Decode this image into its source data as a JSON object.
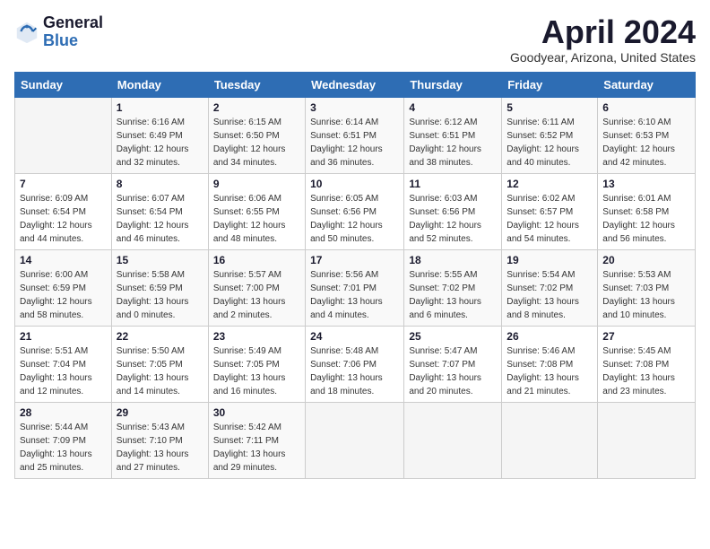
{
  "header": {
    "logo_general": "General",
    "logo_blue": "Blue",
    "title": "April 2024",
    "subtitle": "Goodyear, Arizona, United States"
  },
  "days_of_week": [
    "Sunday",
    "Monday",
    "Tuesday",
    "Wednesday",
    "Thursday",
    "Friday",
    "Saturday"
  ],
  "weeks": [
    [
      {
        "num": "",
        "info": ""
      },
      {
        "num": "1",
        "info": "Sunrise: 6:16 AM\nSunset: 6:49 PM\nDaylight: 12 hours\nand 32 minutes."
      },
      {
        "num": "2",
        "info": "Sunrise: 6:15 AM\nSunset: 6:50 PM\nDaylight: 12 hours\nand 34 minutes."
      },
      {
        "num": "3",
        "info": "Sunrise: 6:14 AM\nSunset: 6:51 PM\nDaylight: 12 hours\nand 36 minutes."
      },
      {
        "num": "4",
        "info": "Sunrise: 6:12 AM\nSunset: 6:51 PM\nDaylight: 12 hours\nand 38 minutes."
      },
      {
        "num": "5",
        "info": "Sunrise: 6:11 AM\nSunset: 6:52 PM\nDaylight: 12 hours\nand 40 minutes."
      },
      {
        "num": "6",
        "info": "Sunrise: 6:10 AM\nSunset: 6:53 PM\nDaylight: 12 hours\nand 42 minutes."
      }
    ],
    [
      {
        "num": "7",
        "info": "Sunrise: 6:09 AM\nSunset: 6:54 PM\nDaylight: 12 hours\nand 44 minutes."
      },
      {
        "num": "8",
        "info": "Sunrise: 6:07 AM\nSunset: 6:54 PM\nDaylight: 12 hours\nand 46 minutes."
      },
      {
        "num": "9",
        "info": "Sunrise: 6:06 AM\nSunset: 6:55 PM\nDaylight: 12 hours\nand 48 minutes."
      },
      {
        "num": "10",
        "info": "Sunrise: 6:05 AM\nSunset: 6:56 PM\nDaylight: 12 hours\nand 50 minutes."
      },
      {
        "num": "11",
        "info": "Sunrise: 6:03 AM\nSunset: 6:56 PM\nDaylight: 12 hours\nand 52 minutes."
      },
      {
        "num": "12",
        "info": "Sunrise: 6:02 AM\nSunset: 6:57 PM\nDaylight: 12 hours\nand 54 minutes."
      },
      {
        "num": "13",
        "info": "Sunrise: 6:01 AM\nSunset: 6:58 PM\nDaylight: 12 hours\nand 56 minutes."
      }
    ],
    [
      {
        "num": "14",
        "info": "Sunrise: 6:00 AM\nSunset: 6:59 PM\nDaylight: 12 hours\nand 58 minutes."
      },
      {
        "num": "15",
        "info": "Sunrise: 5:58 AM\nSunset: 6:59 PM\nDaylight: 13 hours\nand 0 minutes."
      },
      {
        "num": "16",
        "info": "Sunrise: 5:57 AM\nSunset: 7:00 PM\nDaylight: 13 hours\nand 2 minutes."
      },
      {
        "num": "17",
        "info": "Sunrise: 5:56 AM\nSunset: 7:01 PM\nDaylight: 13 hours\nand 4 minutes."
      },
      {
        "num": "18",
        "info": "Sunrise: 5:55 AM\nSunset: 7:02 PM\nDaylight: 13 hours\nand 6 minutes."
      },
      {
        "num": "19",
        "info": "Sunrise: 5:54 AM\nSunset: 7:02 PM\nDaylight: 13 hours\nand 8 minutes."
      },
      {
        "num": "20",
        "info": "Sunrise: 5:53 AM\nSunset: 7:03 PM\nDaylight: 13 hours\nand 10 minutes."
      }
    ],
    [
      {
        "num": "21",
        "info": "Sunrise: 5:51 AM\nSunset: 7:04 PM\nDaylight: 13 hours\nand 12 minutes."
      },
      {
        "num": "22",
        "info": "Sunrise: 5:50 AM\nSunset: 7:05 PM\nDaylight: 13 hours\nand 14 minutes."
      },
      {
        "num": "23",
        "info": "Sunrise: 5:49 AM\nSunset: 7:05 PM\nDaylight: 13 hours\nand 16 minutes."
      },
      {
        "num": "24",
        "info": "Sunrise: 5:48 AM\nSunset: 7:06 PM\nDaylight: 13 hours\nand 18 minutes."
      },
      {
        "num": "25",
        "info": "Sunrise: 5:47 AM\nSunset: 7:07 PM\nDaylight: 13 hours\nand 20 minutes."
      },
      {
        "num": "26",
        "info": "Sunrise: 5:46 AM\nSunset: 7:08 PM\nDaylight: 13 hours\nand 21 minutes."
      },
      {
        "num": "27",
        "info": "Sunrise: 5:45 AM\nSunset: 7:08 PM\nDaylight: 13 hours\nand 23 minutes."
      }
    ],
    [
      {
        "num": "28",
        "info": "Sunrise: 5:44 AM\nSunset: 7:09 PM\nDaylight: 13 hours\nand 25 minutes."
      },
      {
        "num": "29",
        "info": "Sunrise: 5:43 AM\nSunset: 7:10 PM\nDaylight: 13 hours\nand 27 minutes."
      },
      {
        "num": "30",
        "info": "Sunrise: 5:42 AM\nSunset: 7:11 PM\nDaylight: 13 hours\nand 29 minutes."
      },
      {
        "num": "",
        "info": ""
      },
      {
        "num": "",
        "info": ""
      },
      {
        "num": "",
        "info": ""
      },
      {
        "num": "",
        "info": ""
      }
    ]
  ]
}
